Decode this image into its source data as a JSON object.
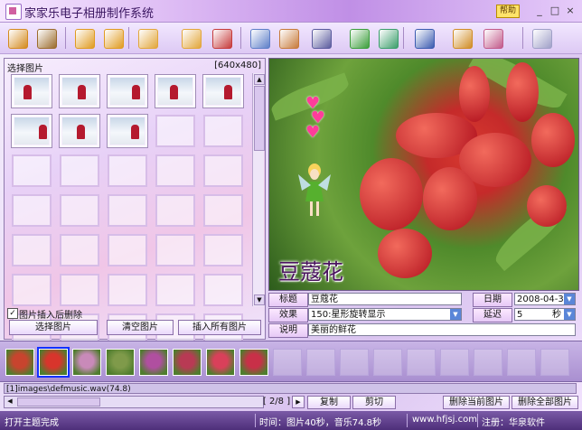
{
  "window": {
    "title": "家家乐电子相册制作系统",
    "help_label": "帮助",
    "controls": {
      "minimize": "_",
      "maximize": "□",
      "close": "×"
    }
  },
  "toolbar": {
    "buttons": [
      {
        "icon": "new-album-icon",
        "color": "#d48a1e"
      },
      {
        "icon": "album-icon",
        "color": "#9b6b2c"
      },
      {
        "icon": "save-icon",
        "color": "#e09b20"
      },
      {
        "icon": "save-all-icon",
        "color": "#e09b20"
      },
      {
        "icon": "page-icon",
        "color": "#e2a63a"
      },
      {
        "icon": "frame-icon",
        "color": "#e2a63a"
      },
      {
        "icon": "delete-frame-icon",
        "color": "#c63b3b"
      },
      {
        "icon": "image-edit-icon",
        "color": "#5e7ec8"
      },
      {
        "icon": "effects-icon",
        "color": "#c77a3a"
      },
      {
        "icon": "music-icon",
        "color": "#5b5b9e"
      },
      {
        "icon": "check-icon",
        "color": "#3b9e3b"
      },
      {
        "icon": "export-icon",
        "color": "#3b9e6b"
      },
      {
        "icon": "screen-icon",
        "color": "#3b5bb0"
      },
      {
        "icon": "tools-icon",
        "color": "#d08c24"
      },
      {
        "icon": "palette-icon",
        "color": "#c25a8a"
      },
      {
        "icon": "cd-burn-icon",
        "color": "#a0a0c8"
      }
    ]
  },
  "picker": {
    "title": "选择图片",
    "size_label": "[640x480]",
    "photo_count": 8,
    "delete_after_insert": true,
    "delete_after_insert_label": "图片插入后删除",
    "select_button": "选择图片",
    "clear_button": "清空图片",
    "insert_all_button": "插入所有图片"
  },
  "preview": {
    "caption": "豆蔻花"
  },
  "form": {
    "title_label": "标题",
    "title_value": "豆蔻花",
    "date_label": "日期",
    "date_value": "2008-04-30",
    "effect_label": "效果",
    "effect_value": "150:星形旋转显示",
    "delay_label": "延迟",
    "delay_value": "5",
    "delay_unit": "秒",
    "desc_label": "说明",
    "desc_value": "美丽的鲜花"
  },
  "filmstrip": {
    "thumbs": [
      {
        "color": "#c8442e"
      },
      {
        "color": "#d8352c"
      },
      {
        "color": "#c98ab9"
      },
      {
        "color": "#7f9a4a"
      },
      {
        "color": "#b04fa0"
      },
      {
        "color": "#b83a54"
      },
      {
        "color": "#d9405a"
      },
      {
        "color": "#c83048"
      }
    ],
    "selected_index": 1
  },
  "music": {
    "path": "[1]images\\defmusic.wav(74.8)"
  },
  "pager": {
    "label": "[ 2/8 ]"
  },
  "actions": {
    "copy": "复制",
    "cut": "剪切",
    "delete_current": "删除当前图片",
    "delete_all": "删除全部图片"
  },
  "status": {
    "left": "打开主题完成",
    "time": "时间：图片40秒，音乐74.8秒",
    "site": "www.hfjsj.com",
    "reg": "注册：华泉软件"
  }
}
